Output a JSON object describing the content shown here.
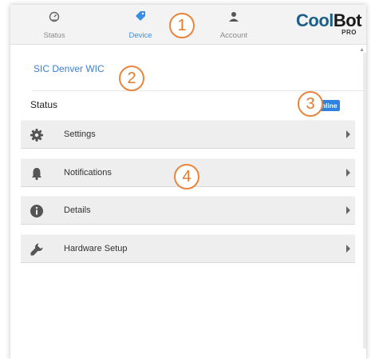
{
  "nav": {
    "tabs": [
      {
        "label": "Status",
        "icon": "speedometer-icon"
      },
      {
        "label": "Device",
        "icon": "tag-icon",
        "active": true
      },
      {
        "label": "Account",
        "icon": "person-icon"
      }
    ],
    "logo": {
      "cool": "Cool",
      "bot": "Bot",
      "pro": "PRO"
    }
  },
  "device": {
    "name": "SIC Denver WIC",
    "status_label": "Status",
    "status_badge": "Online"
  },
  "menu": [
    {
      "label": "Settings",
      "icon": "gear-icon"
    },
    {
      "label": "Notifications",
      "icon": "bell-icon"
    },
    {
      "label": "Details",
      "icon": "info-icon"
    },
    {
      "label": "Hardware Setup",
      "icon": "wrench-icon"
    }
  ],
  "callouts": [
    "1",
    "2",
    "3",
    "4"
  ],
  "colors": {
    "accent": "#3a8ee6",
    "badge": "#2f82e0",
    "callout": "#e8853d",
    "logo": "#1c5f88"
  }
}
